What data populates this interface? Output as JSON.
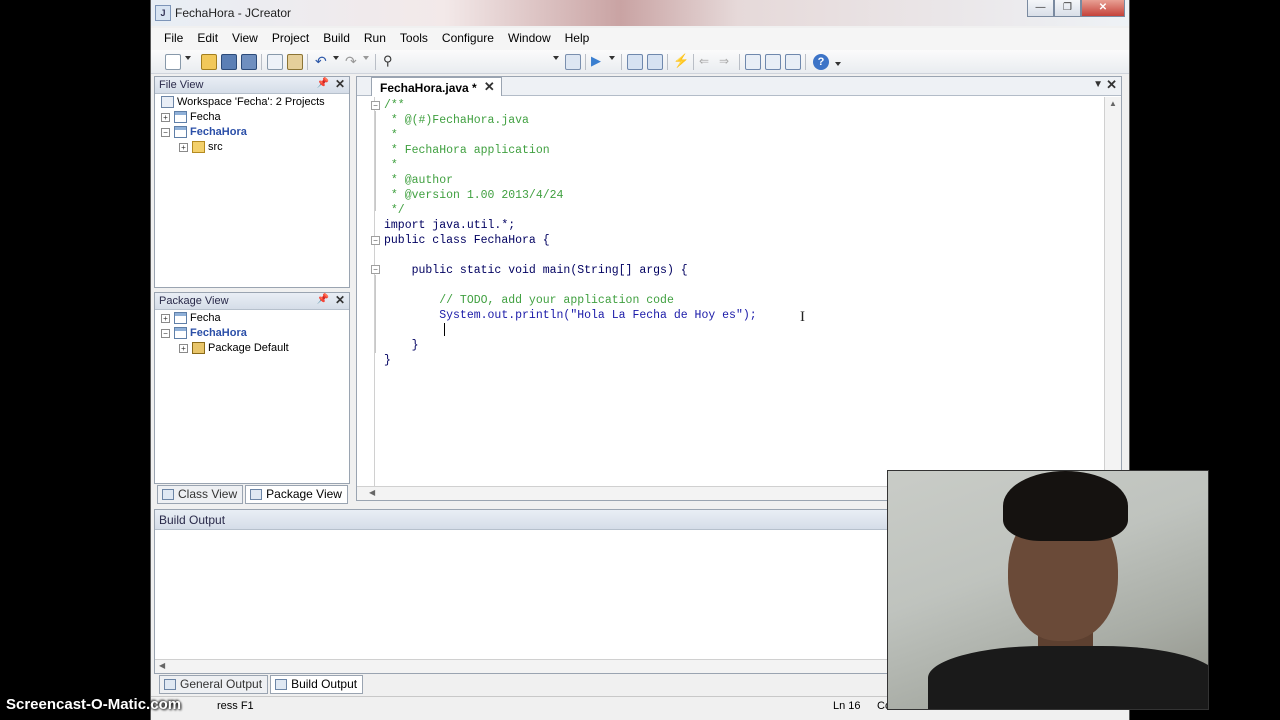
{
  "window": {
    "title": "FechaHora - JCreator",
    "controls": [
      "—",
      "❐",
      "✕"
    ]
  },
  "menu": [
    "File",
    "Edit",
    "View",
    "Project",
    "Build",
    "Run",
    "Tools",
    "Configure",
    "Window",
    "Help"
  ],
  "file_view": {
    "title": "File View",
    "items": [
      "Workspace 'Fecha': 2 Projects",
      "Fecha",
      "FechaHora",
      "src"
    ]
  },
  "package_view": {
    "title": "Package View",
    "items": [
      "Fecha",
      "FechaHora",
      "Package Default"
    ]
  },
  "left_tabs": [
    "Class View",
    "Package View"
  ],
  "editor": {
    "tab_label": "FechaHora.java *",
    "lines": [
      "/**",
      " * @(#)FechaHora.java",
      " *",
      " * FechaHora application",
      " *",
      " * @author",
      " * @version 1.00 2013/4/24",
      " */",
      "import java.util.*;",
      "public class FechaHora {",
      "",
      "    public static void main(String[] args) {",
      "",
      "        // TODO, add your application code",
      "        System.out.println(\"Hola La Fecha de Hoy es\");",
      "        ",
      "    }",
      "}"
    ]
  },
  "build_output": {
    "title": "Build Output"
  },
  "bottom_tabs": [
    "General Output",
    "Build Output"
  ],
  "status": {
    "help": "ress F1",
    "line": "Ln 16",
    "col": "Co"
  },
  "watermark": "Screencast-O-Matic.com",
  "colors": {
    "comment": "#40a040",
    "keyword": "#00008b",
    "string": "#1a1aa8",
    "tab_accent": "#2b4fa8"
  }
}
